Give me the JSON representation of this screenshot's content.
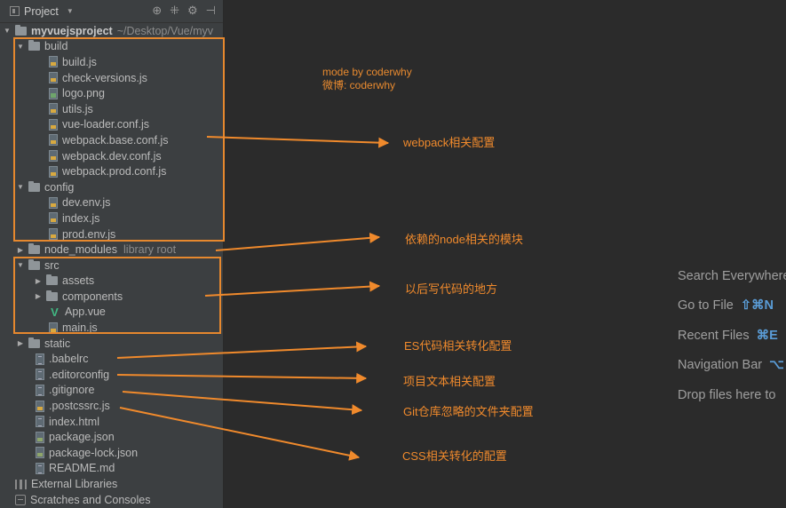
{
  "header": {
    "title": "Project",
    "tools": [
      "⊕",
      "⁜",
      "⚙",
      "⊣"
    ]
  },
  "tree": {
    "project": {
      "name": "myvuejsproject",
      "path": "~/Desktop/Vue/myv"
    },
    "build": {
      "label": "build",
      "files": [
        "build.js",
        "check-versions.js",
        "logo.png",
        "utils.js",
        "vue-loader.conf.js",
        "webpack.base.conf.js",
        "webpack.dev.conf.js",
        "webpack.prod.conf.js"
      ]
    },
    "config": {
      "label": "config",
      "files": [
        "dev.env.js",
        "index.js",
        "prod.env.js"
      ]
    },
    "node_modules": {
      "label": "node_modules",
      "note": "library root"
    },
    "src": {
      "label": "src",
      "folders": [
        "assets",
        "components"
      ],
      "files": [
        "App.vue",
        "main.js"
      ]
    },
    "static": {
      "label": "static"
    },
    "root_files": [
      ".babelrc",
      ".editorconfig",
      ".gitignore",
      ".postcssrc.js",
      "index.html",
      "package.json",
      "package-lock.json",
      "README.md"
    ],
    "external_libraries": "External Libraries",
    "scratches": "Scratches and Consoles"
  },
  "watermark": {
    "line1": "mode by coderwhy",
    "line2": "微博: coderwhy"
  },
  "annotations": {
    "webpack": "webpack相关配置",
    "node_modules": "依赖的node相关的模块",
    "src": "以后写代码的地方",
    "babelrc": "ES代码相关转化配置",
    "editorconfig": "项目文本相关配置",
    "gitignore": "Git仓库忽略的文件夹配置",
    "postcss": "CSS相关转化的配置"
  },
  "hints": [
    {
      "label": "Search Everywhere",
      "key": ""
    },
    {
      "label": "Go to File",
      "key": "⇧⌘N"
    },
    {
      "label": "Recent Files",
      "key": "⌘E"
    },
    {
      "label": "Navigation Bar",
      "key": "⌥"
    },
    {
      "label": "Drop files here to",
      "key": ""
    }
  ],
  "colors": {
    "annotation": "#f08a2c",
    "background": "#2b2b2b",
    "sidebar": "#3c3f41",
    "vue": "#41b883"
  }
}
